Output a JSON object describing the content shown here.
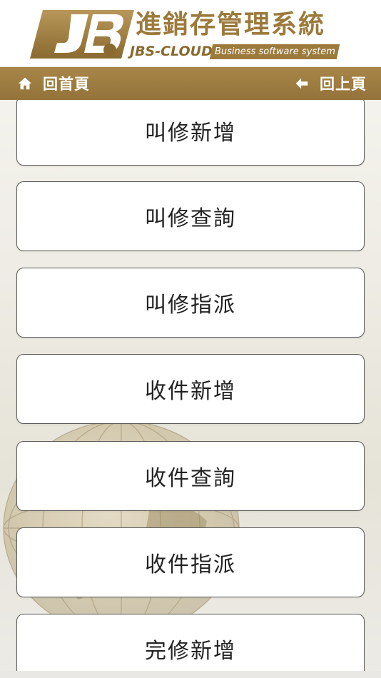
{
  "header": {
    "title": "進銷存管理系統",
    "brand_mark": "JBS",
    "brand_sub": "JBS",
    "cloud": "JBS-CLOUD",
    "tagline": "Business software system"
  },
  "nav": {
    "home_label": "回首頁",
    "back_label": "回上頁"
  },
  "menu": {
    "items": [
      {
        "label": "叫修新增"
      },
      {
        "label": "叫修查詢"
      },
      {
        "label": "叫修指派"
      },
      {
        "label": "收件新增"
      },
      {
        "label": "收件查詢"
      },
      {
        "label": "收件指派"
      },
      {
        "label": "完修新增"
      }
    ]
  },
  "colors": {
    "brand_gold": "#9c7a3c",
    "navbar_top": "#a88648",
    "navbar_bottom": "#93733a",
    "button_border": "#5a5a5a"
  }
}
